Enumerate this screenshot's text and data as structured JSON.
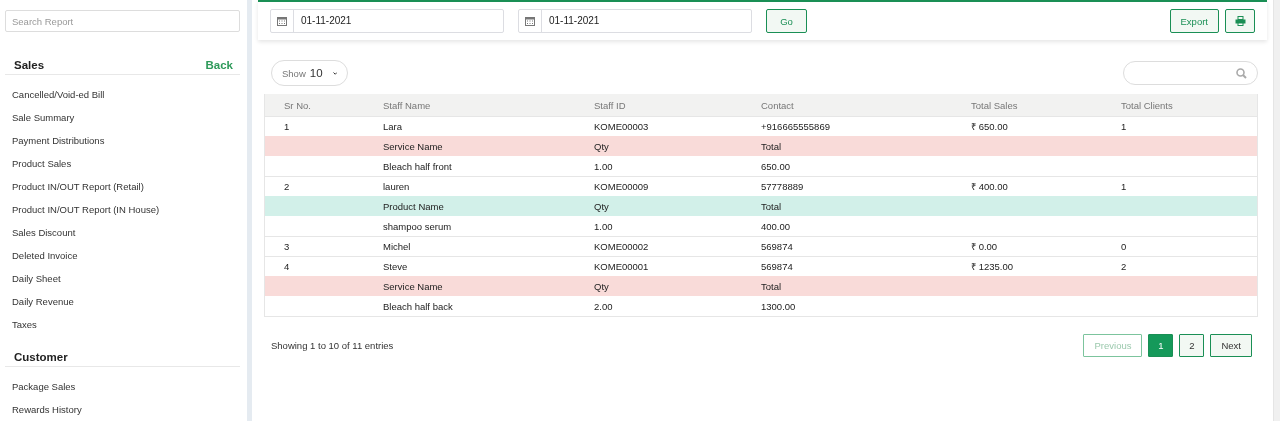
{
  "sidebar": {
    "search": {
      "placeholder": "Search Report"
    },
    "sections": [
      {
        "title": "Sales",
        "back": "Back",
        "items": [
          "Cancelled/Void-ed Bill",
          "Sale Summary",
          "Payment Distributions",
          "Product Sales",
          "Product IN/OUT Report (Retail)",
          "Product IN/OUT Report (IN House)",
          "Sales Discount",
          "Deleted Invoice",
          "Daily Sheet",
          "Daily Revenue",
          "Taxes"
        ]
      },
      {
        "title": "Customer",
        "items": [
          "Package Sales",
          "Rewards History"
        ]
      }
    ]
  },
  "filters": {
    "from_date": "01-11-2021",
    "to_date": "01-11-2021",
    "go": "Go",
    "export": "Export"
  },
  "table_controls": {
    "show_label": "Show",
    "show_value": "10"
  },
  "table": {
    "columns": [
      "Sr No.",
      "Staff Name",
      "Staff ID",
      "Contact",
      "Total Sales",
      "Total Clients"
    ],
    "rows": [
      {
        "kind": "staff",
        "cells": [
          "1",
          "Lara",
          "KOME00003",
          "+916665555869",
          "₹ 650.00",
          "1"
        ]
      },
      {
        "kind": "detail_header",
        "color": "#f9dbd9",
        "cells": [
          "Service Name",
          "Qty",
          "Total"
        ]
      },
      {
        "kind": "detail",
        "cells": [
          "Bleach half front",
          "1.00",
          "650.00"
        ]
      },
      {
        "kind": "staff",
        "cells": [
          "2",
          "lauren",
          "KOME00009",
          "57778889",
          "₹ 400.00",
          "1"
        ]
      },
      {
        "kind": "detail_header",
        "color": "#d2f0e9",
        "cells": [
          "Product Name",
          "Qty",
          "Total"
        ]
      },
      {
        "kind": "detail",
        "cells": [
          "shampoo serum",
          "1.00",
          "400.00"
        ]
      },
      {
        "kind": "staff",
        "cells": [
          "3",
          "Michel",
          "KOME00002",
          "569874",
          "₹ 0.00",
          "0"
        ]
      },
      {
        "kind": "staff",
        "cells": [
          "4",
          "Steve",
          "KOME00001",
          "569874",
          "₹ 1235.00",
          "2"
        ]
      },
      {
        "kind": "detail_header",
        "color": "#f9dbd9",
        "cells": [
          "Service Name",
          "Qty",
          "Total"
        ]
      },
      {
        "kind": "detail",
        "cells": [
          "Bleach half back",
          "2.00",
          "1300.00"
        ]
      }
    ]
  },
  "footer": {
    "info": "Showing 1 to 10 of 11 entries"
  },
  "pagination": {
    "previous": {
      "label": "Previous",
      "disabled": true
    },
    "pages": [
      {
        "label": "1",
        "selected": true
      },
      {
        "label": "2",
        "selected": false
      }
    ],
    "next": {
      "label": "Next",
      "disabled": false
    }
  }
}
